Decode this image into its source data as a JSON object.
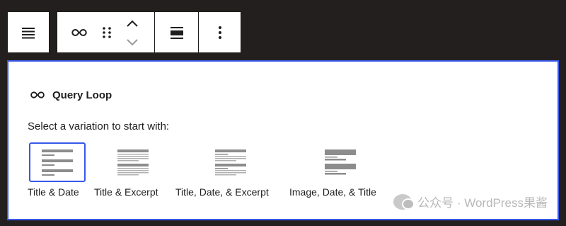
{
  "toolbar": {
    "buttons": [
      {
        "icon": "align-justify-icon",
        "interactable": true
      },
      {
        "icon": "loop-icon",
        "interactable": true
      },
      {
        "icon": "drag-handle-icon",
        "interactable": true
      },
      {
        "icon": "move-up-icon",
        "interactable": true
      },
      {
        "icon": "move-down-icon",
        "interactable": true
      },
      {
        "icon": "block-width-icon",
        "interactable": true
      },
      {
        "icon": "more-options-icon",
        "interactable": true
      }
    ]
  },
  "placeholder": {
    "title": "Query Loop",
    "instruction": "Select a variation to start with:",
    "accent_color": "#3858e9",
    "variations": [
      {
        "label": "Title & Date",
        "selected": true
      },
      {
        "label": "Title & Excerpt",
        "selected": false
      },
      {
        "label": "Title, Date, & Excerpt",
        "selected": false
      },
      {
        "label": "Image, Date, & Title",
        "selected": false
      }
    ]
  },
  "watermark": {
    "text": "公众号 · WordPress果酱"
  }
}
